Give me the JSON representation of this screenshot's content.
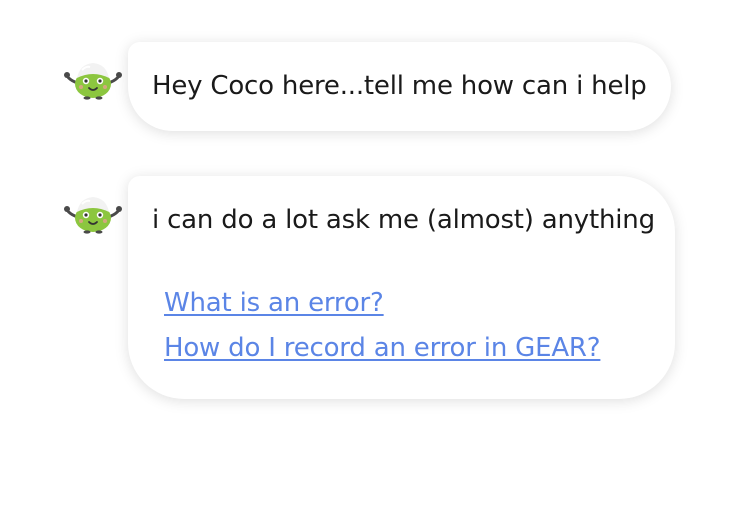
{
  "messages": [
    {
      "sender_icon": "coconut-mascot-icon",
      "text": "Hey Coco here...tell me how can i help"
    },
    {
      "sender_icon": "coconut-mascot-icon",
      "text": "i can do a lot ask me (almost) anything",
      "suggestions": [
        "What is an error?",
        "How do I record an error in GEAR?"
      ]
    }
  ],
  "colors": {
    "bubble_background": "#ffffff",
    "message_text": "#1a1a1a",
    "link": "#5b85e6",
    "mascot_green": "#8cc63f"
  }
}
